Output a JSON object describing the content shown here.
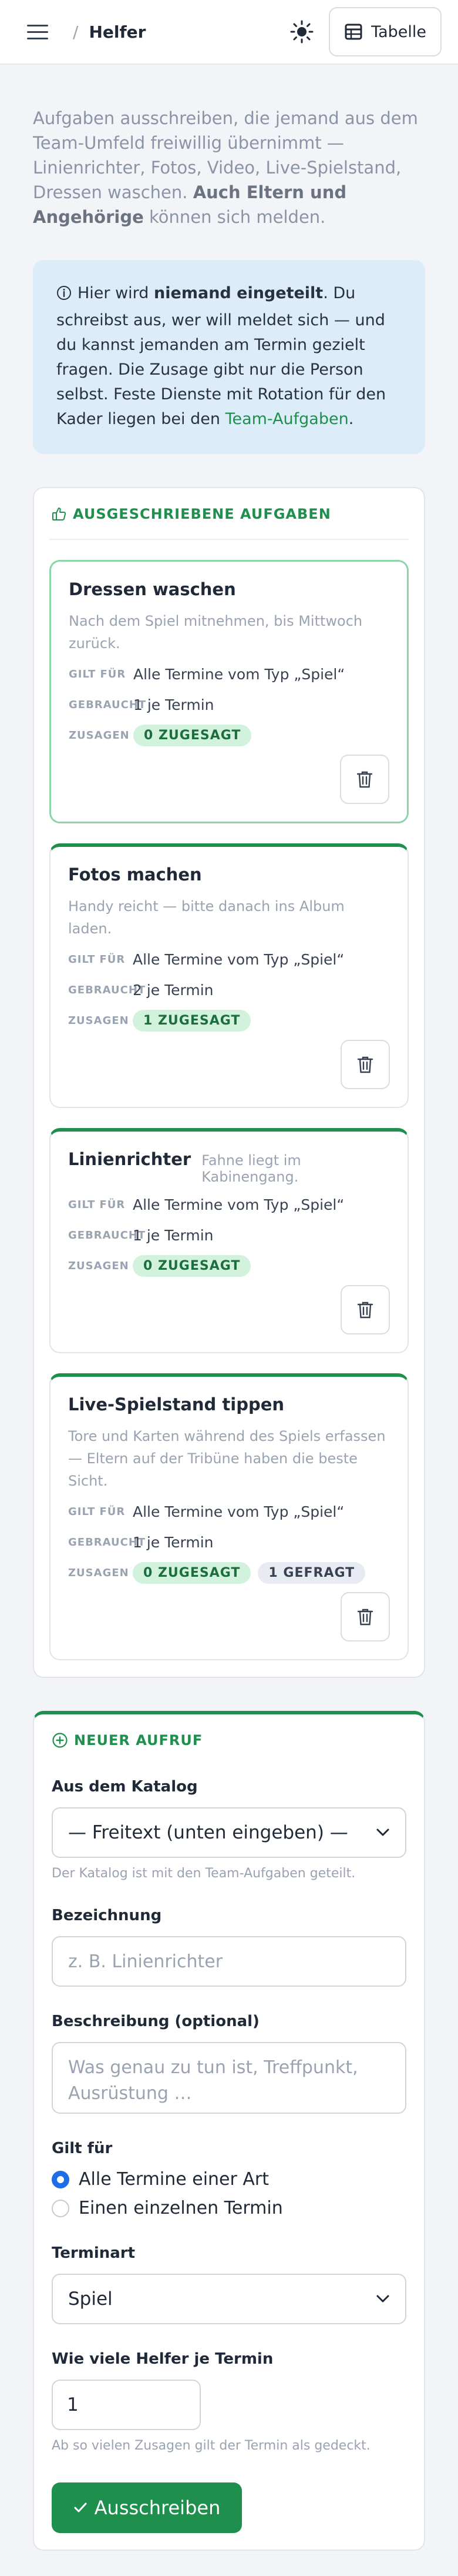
{
  "header": {
    "breadcrumb_sep": "/",
    "title": "Helfer",
    "theme_icon": "sun-icon",
    "view_button_label": "Tabelle",
    "view_button_icon": "table-icon",
    "menu_icon": "hamburger-icon"
  },
  "intro": {
    "text": "Aufgaben ausschreiben, die jemand aus dem Team-Umfeld freiwillig übernimmt — Linienrichter, Fotos, Video, Live-Spielstand, Dressen waschen.",
    "bold": "Auch Eltern und Angehörige",
    "tail": "können sich melden."
  },
  "info": {
    "icon": "info-icon",
    "pre": "Hier wird",
    "bold": "niemand eingeteilt",
    "text": ". Du schreibst aus, wer will meldet sich — und du kannst jemanden am Termin gezielt fragen. Die Zusage gibt nur die Person selbst. Feste Dienste mit Rotation für den Kader liegen bei den",
    "link": "Team-Aufgaben",
    "end": "."
  },
  "tasks_section": {
    "icon": "thumbs-up-icon",
    "title": "AUSGESCHRIEBENE AUFGABEN",
    "label_applies": "GILT FÜR",
    "label_needed": "GEBRAUCHT",
    "label_commits": "ZUSAGEN",
    "items": [
      {
        "title": "Dressen waschen",
        "desc": "Nach dem Spiel mitnehmen, bis Mittwoch zurück.",
        "applies": "Alle Termine vom Typ „Spiel“",
        "needed": "1 je Termin",
        "commits": "0 ZUGESAGT"
      },
      {
        "title": "Fotos machen",
        "desc": "Handy reicht — bitte danach ins Album laden.",
        "applies": "Alle Termine vom Typ „Spiel“",
        "needed": "2 je Termin",
        "commits": "1 ZUGESAGT"
      },
      {
        "title": "Linienrichter",
        "note": "Fahne liegt im Kabinengang.",
        "applies": "Alle Termine vom Typ „Spiel“",
        "needed": "1 je Termin",
        "commits": "0 ZUGESAGT"
      },
      {
        "title": "Live-Spielstand tippen",
        "desc": "Tore und Karten während des Spiels erfassen — Eltern auf der Tribüne haben die beste Sicht.",
        "applies": "Alle Termine vom Typ „Spiel“",
        "needed": "1 je Termin",
        "commits": "0 ZUGESAGT",
        "asked": "1 GEFRAGT"
      }
    ]
  },
  "new_call": {
    "icon": "plus-circle-icon",
    "title": "NEUER AUFRUF",
    "catalog_label": "Aus dem Katalog",
    "catalog_value": "— Freitext (unten eingeben) —",
    "catalog_hint": "Der Katalog ist mit den Team-Aufgaben geteilt.",
    "name_label": "Bezeichnung",
    "name_placeholder": "z. B. Linienrichter",
    "desc_label": "Beschreibung (optional)",
    "desc_placeholder": "Was genau zu tun ist, Treffpunkt, Ausrüstung …",
    "applies_label": "Gilt für",
    "option_all": "Alle Termine einer Art",
    "option_single": "Einen einzelnen Termin",
    "selected_option": "Alle Termine einer Art",
    "type_label": "Terminart",
    "type_value": "Spiel",
    "count_label": "Wie viele Helfer je Termin",
    "count_value": "1",
    "count_hint": "Ab so vielen Zusagen gilt der Termin als gedeckt.",
    "submit_label": "Ausschreiben"
  },
  "colors": {
    "accent_green": "#1f8f4e",
    "info_bg": "#dcecf9",
    "radio_blue": "#1d6ee8",
    "page_bg": "#f3f4f8"
  }
}
